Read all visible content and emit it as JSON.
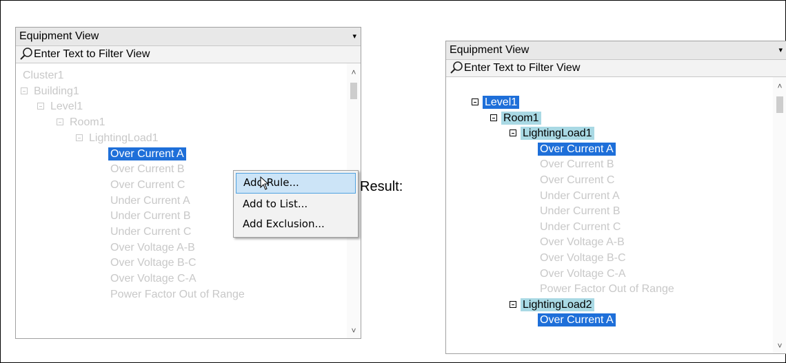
{
  "left_panel": {
    "combo_value": "Equipment View",
    "combo_arrow": "▾",
    "filter_placeholder": "Enter Text to Filter View",
    "tree": [
      {
        "label": "Cluster1",
        "toggle": false
      },
      {
        "label": "Building1",
        "toggle": true
      },
      {
        "label": "Level1",
        "toggle": true
      },
      {
        "label": "Room1",
        "toggle": true
      },
      {
        "label": "LightingLoad1",
        "toggle": true
      },
      {
        "label": "Over Current A",
        "toggle": false,
        "state": "selected"
      },
      {
        "label": "Over Current B",
        "toggle": false
      },
      {
        "label": "Over Current C",
        "toggle": false
      },
      {
        "label": "Under Current A",
        "toggle": false
      },
      {
        "label": "Under Current B",
        "toggle": false
      },
      {
        "label": "Under Current C",
        "toggle": false
      },
      {
        "label": "Over Voltage A-B",
        "toggle": false
      },
      {
        "label": "Over Voltage B-C",
        "toggle": false
      },
      {
        "label": "Over Voltage C-A",
        "toggle": false
      },
      {
        "label": "Power Factor Out of Range",
        "toggle": false
      }
    ]
  },
  "context_menu": {
    "items": [
      "Add Rule...",
      "Add to List...",
      "Add Exclusion..."
    ],
    "hovered_item": "Add Rule..."
  },
  "result_label": "Result:",
  "right_panel": {
    "combo_value": "Equipment View",
    "combo_arrow": "▾",
    "filter_placeholder": "Enter Text to Filter View",
    "tree": [
      {
        "label": "Level1",
        "toggle": true,
        "state": "selected"
      },
      {
        "label": "Room1",
        "toggle": true,
        "state": "highlighted"
      },
      {
        "label": "LightingLoad1",
        "toggle": true,
        "state": "highlighted"
      },
      {
        "label": "Over Current A",
        "toggle": false,
        "state": "selected"
      },
      {
        "label": "Over Current B",
        "toggle": false
      },
      {
        "label": "Over Current C",
        "toggle": false
      },
      {
        "label": "Under Current A",
        "toggle": false
      },
      {
        "label": "Under Current B",
        "toggle": false
      },
      {
        "label": "Under Current C",
        "toggle": false
      },
      {
        "label": "Over Voltage A-B",
        "toggle": false
      },
      {
        "label": "Over Voltage B-C",
        "toggle": false
      },
      {
        "label": "Over Voltage C-A",
        "toggle": false
      },
      {
        "label": "Power Factor Out of Range",
        "toggle": false
      },
      {
        "label": "LightingLoad2",
        "toggle": true,
        "state": "highlighted"
      },
      {
        "label": "Over Current A",
        "toggle": false,
        "state": "selected"
      }
    ]
  },
  "colors": {
    "selected": "#1e6fd9",
    "highlighted": "#a9d9e4",
    "dim_text": "#c8c8c8"
  },
  "icons": {
    "filter": "search-icon",
    "collapse": "minus-box-icon",
    "cursor": "pointer-arrow-icon"
  }
}
